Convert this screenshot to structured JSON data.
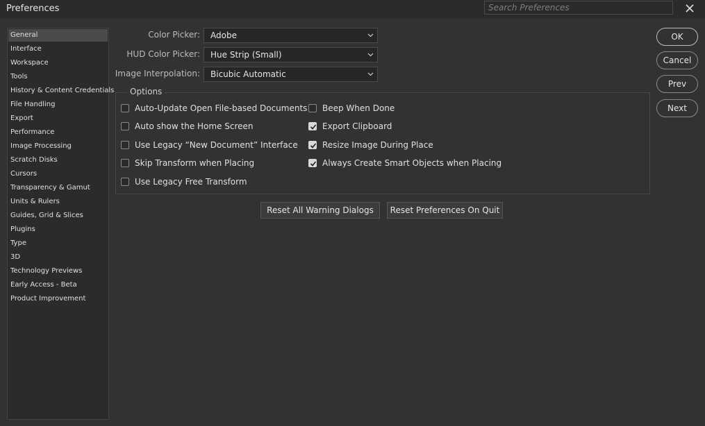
{
  "window": {
    "title": "Preferences"
  },
  "search": {
    "placeholder": "Search Preferences"
  },
  "sidebar": {
    "items": [
      {
        "label": "General",
        "selected": true
      },
      {
        "label": "Interface"
      },
      {
        "label": "Workspace"
      },
      {
        "label": "Tools"
      },
      {
        "label": "History & Content Credentials"
      },
      {
        "label": "File Handling"
      },
      {
        "label": "Export"
      },
      {
        "label": "Performance"
      },
      {
        "label": "Image Processing"
      },
      {
        "label": "Scratch Disks"
      },
      {
        "label": "Cursors"
      },
      {
        "label": "Transparency & Gamut"
      },
      {
        "label": "Units & Rulers"
      },
      {
        "label": "Guides, Grid & Slices"
      },
      {
        "label": "Plugins"
      },
      {
        "label": "Type"
      },
      {
        "label": "3D"
      },
      {
        "label": "Technology Previews"
      },
      {
        "label": "Early Access - Beta"
      },
      {
        "label": "Product Improvement"
      }
    ]
  },
  "fields": {
    "color_picker": {
      "label": "Color Picker:",
      "value": "Adobe"
    },
    "hud_color_picker": {
      "label": "HUD Color Picker:",
      "value": "Hue Strip (Small)"
    },
    "image_interpolation": {
      "label": "Image Interpolation:",
      "value": "Bicubic Automatic"
    }
  },
  "options": {
    "legend": "Options",
    "left": [
      {
        "label": "Auto-Update Open File-based Documents",
        "checked": false
      },
      {
        "label": "Auto show the Home Screen",
        "checked": false
      },
      {
        "label": "Use Legacy “New Document” Interface",
        "checked": false
      },
      {
        "label": "Skip Transform when Placing",
        "checked": false
      },
      {
        "label": "Use Legacy Free Transform",
        "checked": false
      }
    ],
    "right": [
      {
        "label": "Beep When Done",
        "checked": false
      },
      {
        "label": "Export Clipboard",
        "checked": true
      },
      {
        "label": "Resize Image During Place",
        "checked": true
      },
      {
        "label": "Always Create Smart Objects when Placing",
        "checked": true
      }
    ]
  },
  "reset_buttons": {
    "warning_dialogs": "Reset All Warning Dialogs",
    "prefs_on_quit": "Reset Preferences On Quit"
  },
  "actions": {
    "ok": "OK",
    "cancel": "Cancel",
    "prev": "Prev",
    "next": "Next"
  },
  "colors": {
    "background": "#323232",
    "titlebar": "#2b2b2b",
    "selected_item": "#4b4b4b"
  }
}
